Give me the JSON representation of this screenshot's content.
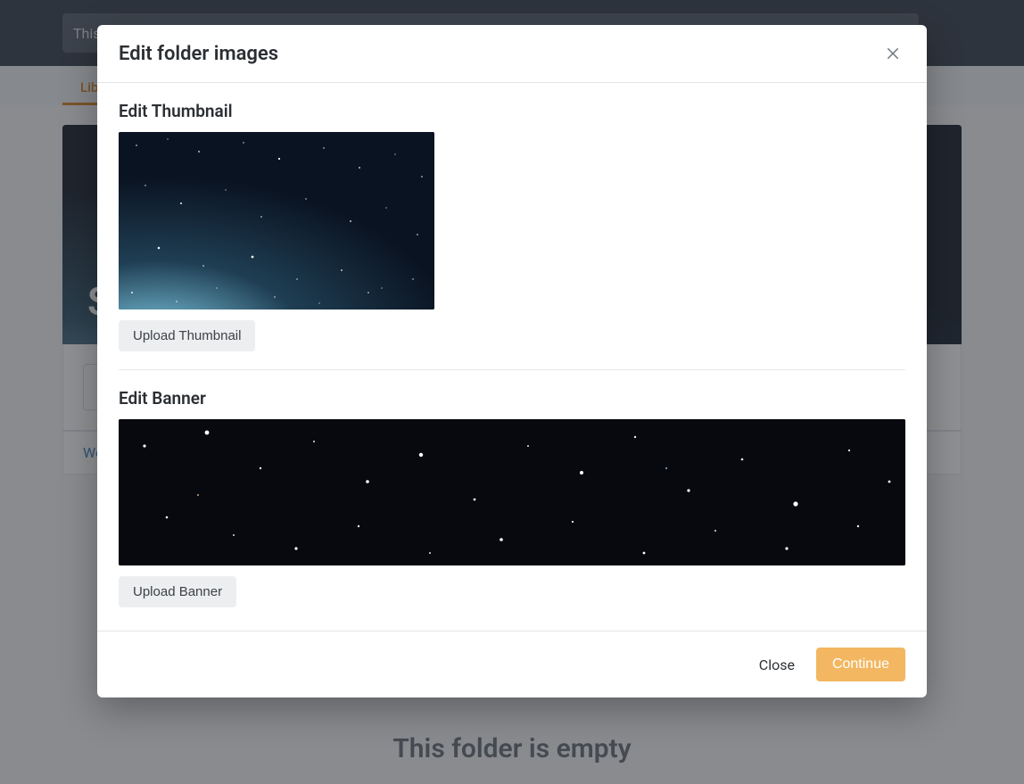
{
  "topbar": {
    "search_text": "This fol"
  },
  "tabs": {
    "library_label": "Libra"
  },
  "banner": {
    "title": "Sc"
  },
  "breadcrumb": {
    "link": "Webi"
  },
  "empty_state": {
    "text": "This folder is empty"
  },
  "modal": {
    "title": "Edit folder images",
    "thumbnail_heading": "Edit Thumbnail",
    "upload_thumbnail_label": "Upload Thumbnail",
    "banner_heading": "Edit Banner",
    "upload_banner_label": "Upload Banner",
    "close_label": "Close",
    "continue_label": "Continue"
  }
}
